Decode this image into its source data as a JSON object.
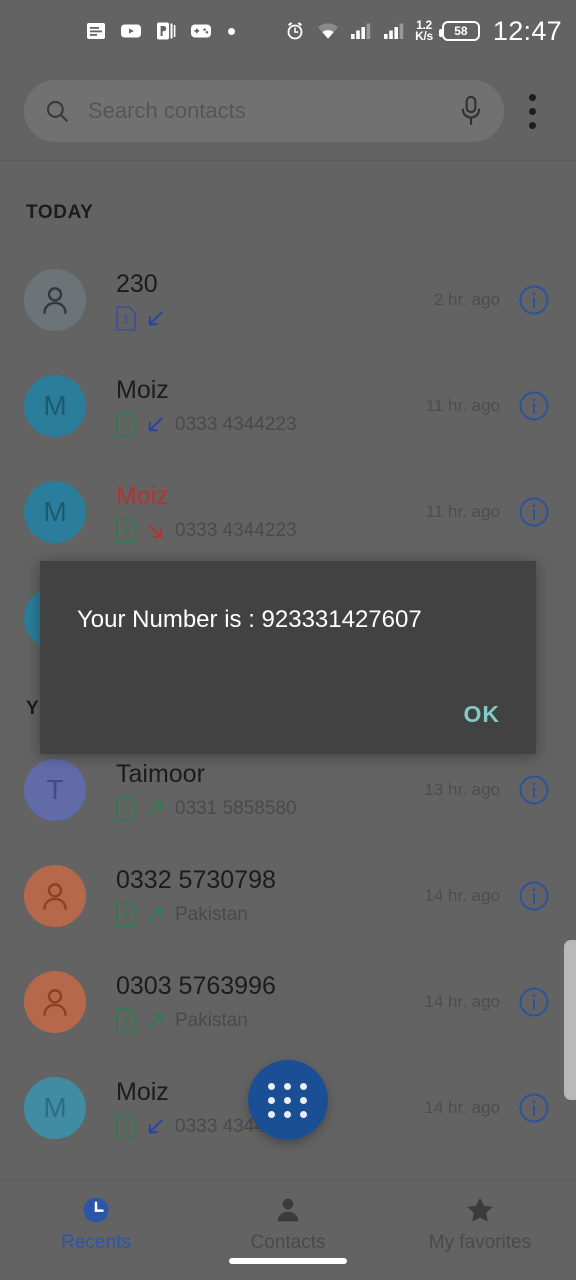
{
  "statusbar": {
    "left_icons": [
      "news-icon",
      "youtube-icon",
      "powerpoint-icon",
      "game-controller-icon",
      "dot-icon"
    ],
    "right_icons": [
      "alarm-icon",
      "wifi-icon",
      "signal-sim1-icon",
      "signal-sim2-icon"
    ],
    "network_speed_value": "1.2",
    "network_speed_unit": "K/s",
    "battery_level": "58",
    "time": "12:47"
  },
  "header": {
    "search_placeholder": "Search contacts",
    "search_value": "",
    "search_icon": "search-icon",
    "mic_icon": "microphone-icon",
    "overflow_icon": "kebab-menu-icon"
  },
  "sections": {
    "today_label": "TODAY",
    "yesterday_label": "YESTERDAY"
  },
  "calls": [
    {
      "name": "230",
      "subtext": "",
      "sim": "1",
      "sim_color": "#3b4fa0",
      "direction": "incoming",
      "time": "2 hr. ago",
      "missed": false,
      "avatar_type": "person",
      "avatar_letter": "",
      "avatar_color": "#6c7478",
      "avatar_glyph_color": "#2f3a40"
    },
    {
      "name": "Moiz",
      "subtext": "0333 4344223",
      "sim": "2",
      "sim_color": "#2e7d4f",
      "direction": "incoming",
      "time": "11 hr. ago",
      "missed": false,
      "avatar_type": "letter",
      "avatar_letter": "M",
      "avatar_color": "#2a7e9b",
      "avatar_glyph_color": "#1b5b72"
    },
    {
      "name": "Moiz",
      "subtext": "0333 4344223",
      "sim": "2",
      "sim_color": "#2e7d4f",
      "direction": "missed",
      "time": "11 hr. ago",
      "missed": true,
      "avatar_type": "letter",
      "avatar_letter": "M",
      "avatar_color": "#2a7e9b",
      "avatar_glyph_color": "#1b5b72"
    },
    {
      "name": "",
      "subtext": "",
      "sim": "",
      "sim_color": "#2e7d4f",
      "direction": "",
      "time": "",
      "missed": false,
      "avatar_type": "letter",
      "avatar_letter": "",
      "avatar_color": "#2a7e9b",
      "avatar_glyph_color": "#1b5b72"
    },
    {
      "name": "Taimoor",
      "subtext": "0331 5858580",
      "sim": "2",
      "sim_color": "#2e7d4f",
      "direction": "outgoing",
      "time": "13 hr. ago",
      "missed": false,
      "avatar_type": "letter",
      "avatar_letter": "T",
      "avatar_color": "#616ba8",
      "avatar_glyph_color": "#414b86"
    },
    {
      "name": "0332 5730798",
      "subtext": "Pakistan",
      "sim": "2",
      "sim_color": "#2e7d4f",
      "direction": "outgoing",
      "time": "14 hr. ago",
      "missed": false,
      "avatar_type": "person",
      "avatar_letter": "",
      "avatar_color": "#b5694a",
      "avatar_glyph_color": "#8f3f22"
    },
    {
      "name": "0303 5763996",
      "subtext": "Pakistan",
      "sim": "2",
      "sim_color": "#2e7d4f",
      "direction": "outgoing",
      "time": "14 hr. ago",
      "missed": false,
      "avatar_type": "person",
      "avatar_letter": "",
      "avatar_color": "#b5694a",
      "avatar_glyph_color": "#8f3f22"
    },
    {
      "name": "Moiz",
      "subtext": "0333 4344223",
      "sim": "2",
      "sim_color": "#2e7d4f",
      "direction": "incoming",
      "time": "14 hr. ago",
      "missed": false,
      "avatar_type": "letter",
      "avatar_letter": "M",
      "avatar_color": "#3f8ca3",
      "avatar_glyph_color": "#2a6e85"
    }
  ],
  "fab": {
    "icon": "dialpad-icon",
    "color": "#1a4f96"
  },
  "dialog": {
    "message": "Your Number is : 923331427607",
    "ok_label": "OK",
    "background": "#424242",
    "ok_color": "#80cbc4"
  },
  "bottom_nav": {
    "items": [
      {
        "label": "Recents",
        "icon": "clock-icon",
        "active": true
      },
      {
        "label": "Contacts",
        "icon": "person-icon",
        "active": false
      },
      {
        "label": "My favorites",
        "icon": "star-icon",
        "active": false
      }
    ]
  },
  "colors": {
    "dim_background": "#636363",
    "accent_blue": "#2b56a8",
    "missed_red": "#b3332f",
    "outgoing_green": "#2e7d4f",
    "incoming_blue": "#2a459c"
  }
}
